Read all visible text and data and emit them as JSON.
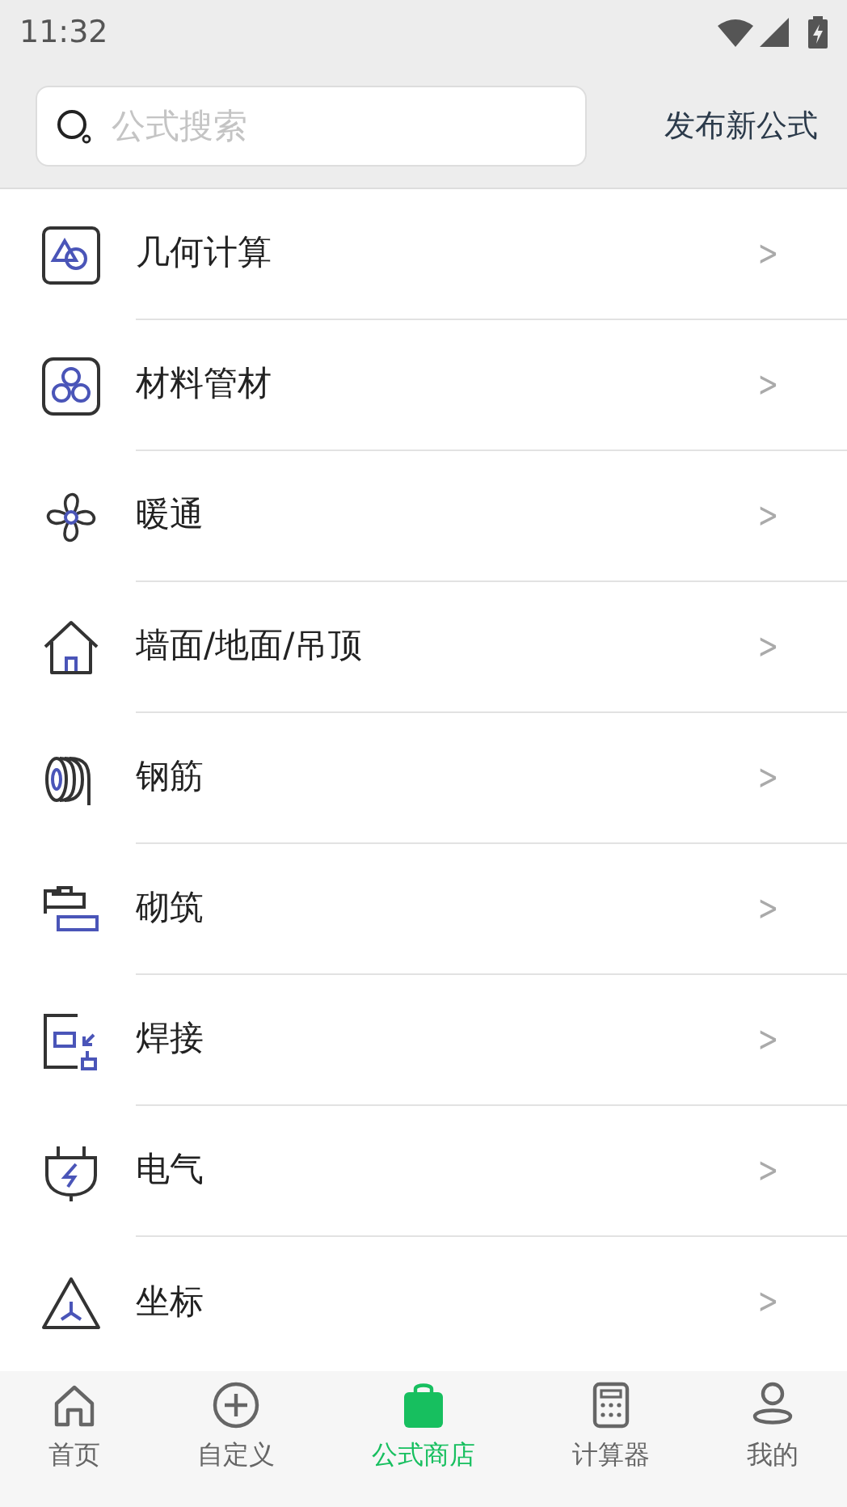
{
  "status_bar": {
    "time": "11:32"
  },
  "search": {
    "placeholder": "公式搜索"
  },
  "publish_button": "发布新公式",
  "categories": [
    {
      "label": "几何计算",
      "arrow": ">"
    },
    {
      "label": "材料管材",
      "arrow": ">"
    },
    {
      "label": "暖通",
      "arrow": ">"
    },
    {
      "label": "墙面/地面/吊顶",
      "arrow": ">"
    },
    {
      "label": "钢筋",
      "arrow": ">"
    },
    {
      "label": "砌筑",
      "arrow": ">"
    },
    {
      "label": "焊接",
      "arrow": ">"
    },
    {
      "label": "电气",
      "arrow": ">"
    },
    {
      "label": "坐标",
      "arrow": ">"
    }
  ],
  "bottom_nav": [
    {
      "label": "首页",
      "selected": false
    },
    {
      "label": "自定义",
      "selected": false
    },
    {
      "label": "公式商店",
      "selected": true
    },
    {
      "label": "计算器",
      "selected": false
    },
    {
      "label": "我的",
      "selected": false
    }
  ]
}
